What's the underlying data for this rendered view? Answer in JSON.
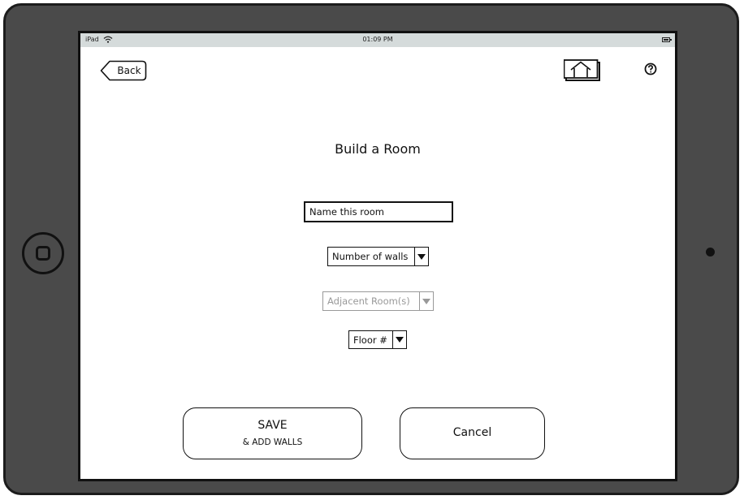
{
  "status_bar": {
    "device": "iPad",
    "time": "01:09 PM"
  },
  "nav": {
    "back_label": "Back",
    "home_icon": "house-icon",
    "help_icon": "question-mark-icon"
  },
  "form": {
    "title": "Build a Room",
    "name_placeholder": "Name this room",
    "name_value": "",
    "walls_select": "Number of walls",
    "adjacent_select": "Adjacent Room(s)",
    "floor_select": "Floor #"
  },
  "actions": {
    "save_label": "SAVE",
    "save_sublabel": "& ADD WALLS",
    "cancel_label": "Cancel"
  }
}
